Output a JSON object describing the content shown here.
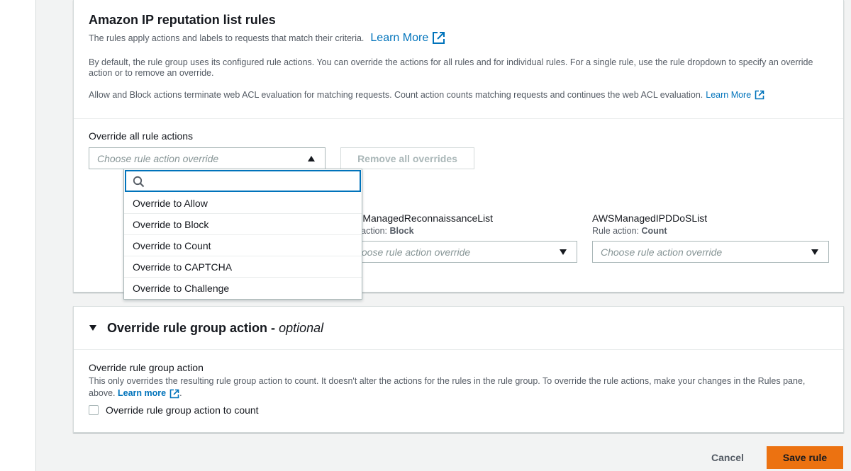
{
  "rules_panel": {
    "title": "Amazon IP reputation list rules",
    "description": "The rules apply actions and labels to requests that match their criteria.",
    "learn_more_label": "Learn More",
    "paragraph_override": "By default, the rule group uses its configured rule actions. You can override the actions for all rules and for individual rules. For a single rule, use the rule dropdown to specify an override action or to remove an override.",
    "paragraph_terminate": "Allow and Block actions terminate web ACL evaluation for matching requests. Count action counts matching requests and continues the web ACL evaluation.",
    "learn_more_small_label": "Learn More",
    "override_all_label": "Override all rule actions",
    "override_all_placeholder": "Choose rule action override",
    "remove_all_label": "Remove all overrides",
    "dropdown": {
      "search_value": "",
      "options": [
        "Override to Allow",
        "Override to Block",
        "Override to Count",
        "Override to CAPTCHA",
        "Override to Challenge"
      ]
    },
    "rules": [
      {
        "name": "AWSManagedReconnaissanceList",
        "action_prefix": "Rule action:",
        "action_value": "Block",
        "select_placeholder": "Choose rule action override"
      },
      {
        "name": "AWSManagedIPDDoSList",
        "action_prefix": "Rule action:",
        "action_value": "Count",
        "select_placeholder": "Choose rule action override"
      }
    ]
  },
  "group_panel": {
    "title": "Override rule group action -",
    "title_optional": "optional",
    "label": "Override rule group action",
    "description": "This only overrides the resulting rule group action to count. It doesn't alter the actions for the rules in the rule group. To override the rule actions, make your changes in the Rules pane, above.",
    "learn_more_label": "Learn more",
    "period": ".",
    "checkbox_label": "Override rule group action to count",
    "checkbox_checked": false
  },
  "footer": {
    "cancel_label": "Cancel",
    "save_label": "Save rule"
  },
  "colors": {
    "link": "#0073bb",
    "primary_button": "#ec7211",
    "border": "#aab7b8"
  },
  "icons": {
    "external_link": "external-link-icon",
    "search": "search-icon",
    "caret": "caret-down-icon"
  }
}
